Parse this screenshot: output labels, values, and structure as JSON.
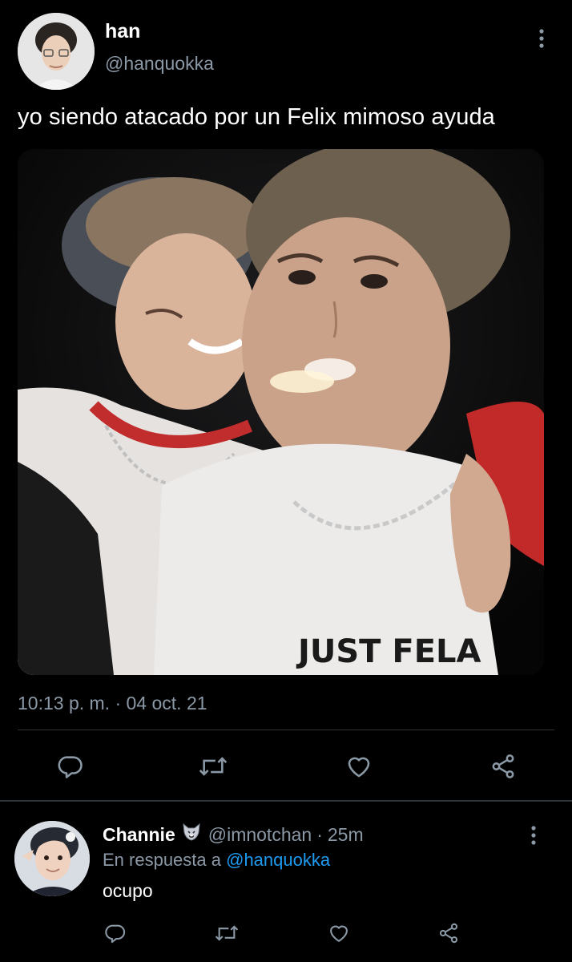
{
  "tweet": {
    "author_name": "han",
    "author_handle": "@hanquokka",
    "text": "yo siendo atacado por un Felix mimoso ayuda",
    "timestamp": "10:13 p. m. · 04 oct. 21",
    "media_printed_text": "JUST FELA"
  },
  "actions": {
    "icons": [
      "reply-icon",
      "retweet-icon",
      "like-icon",
      "share-icon"
    ]
  },
  "reply": {
    "author_name": "Channie",
    "author_emoji": "wolf-emoji",
    "author_handle": "@imnotchan",
    "separator": "·",
    "time": "25m",
    "in_reply_prefix": "En respuesta a",
    "in_reply_handle": "@hanquokka",
    "text": "ocupo"
  },
  "colors": {
    "background": "#000000",
    "primary_text": "#e7e9ea",
    "secondary_text": "#8b98a5",
    "link": "#1d9bf0",
    "divider": "#2f3336"
  }
}
